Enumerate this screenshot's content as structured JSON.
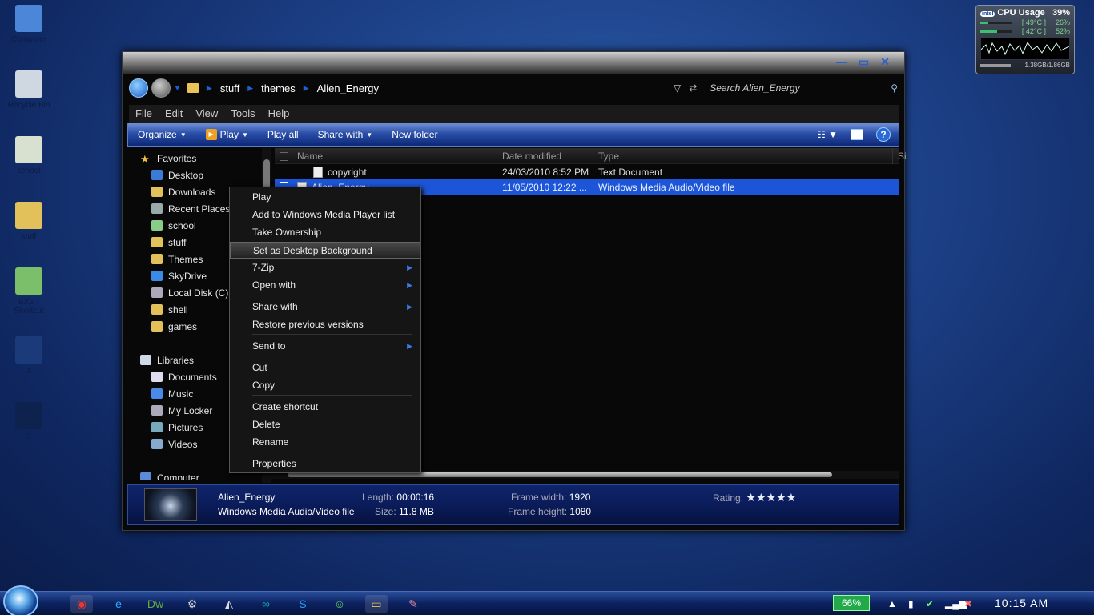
{
  "desktop": {
    "icons": [
      {
        "label": "Computer",
        "icon": "computer-icon",
        "color": "#4b86d8"
      },
      {
        "label": "Recycle Bin",
        "icon": "recycle-bin-icon",
        "color": "#cfd8e0"
      },
      {
        "label": "school",
        "icon": "recycle-folder-icon",
        "color": "#d8e0d0"
      },
      {
        "label": "stuff",
        "icon": "folder-icon",
        "color": "#e3c15a"
      },
      {
        "label": "EXE - Shortcut",
        "icon": "app-icon",
        "color": "#7bbf6a"
      },
      {
        "label": "1",
        "icon": "image-icon",
        "color": "#1b3a7a"
      },
      {
        "label": "2",
        "icon": "image-icon",
        "color": "#0d234d"
      }
    ]
  },
  "gadget": {
    "title": "CPU Usage",
    "total": "39%",
    "core1_temp": "[ 49°C ]",
    "core1_load": "26%",
    "core2_temp": "[ 42°C ]",
    "core2_load": "52%",
    "core1_fill": 0.26,
    "core2_fill": 0.52,
    "memory": "1.38GB/1.86GB",
    "brand": "intel"
  },
  "window": {
    "title_buttons": {
      "minimize": "—",
      "maximize": "▭",
      "close": "✕"
    },
    "breadcrumb": [
      "stuff",
      "themes",
      "Alien_Energy"
    ],
    "search_placeholder": "Search Alien_Energy",
    "menu": [
      "File",
      "Edit",
      "View",
      "Tools",
      "Help"
    ],
    "toolbar": {
      "organize": "Organize",
      "play": "Play",
      "play_all": "Play all",
      "share_with": "Share with",
      "new_folder": "New folder",
      "help": "?"
    },
    "nav": {
      "favorites_header": "Favorites",
      "favorites": [
        {
          "label": "Desktop",
          "color": "#3a7ad8"
        },
        {
          "label": "Downloads",
          "color": "#e3c15a"
        },
        {
          "label": "Recent Places",
          "color": "#9aa"
        },
        {
          "label": "school",
          "color": "#8c8"
        },
        {
          "label": "stuff",
          "color": "#e3c15a"
        },
        {
          "label": "Themes",
          "color": "#e3c15a"
        },
        {
          "label": "SkyDrive",
          "color": "#3a8ae8"
        },
        {
          "label": "Local Disk (C)",
          "color": "#aab"
        },
        {
          "label": "shell",
          "color": "#e3c15a"
        },
        {
          "label": "games",
          "color": "#e3c15a"
        }
      ],
      "libraries_header": "Libraries",
      "libraries": [
        {
          "label": "Documents",
          "color": "#dde"
        },
        {
          "label": "Music",
          "color": "#4a8ae8"
        },
        {
          "label": "My Locker",
          "color": "#aab"
        },
        {
          "label": "Pictures",
          "color": "#7ab"
        },
        {
          "label": "Videos",
          "color": "#8ac"
        }
      ],
      "computer_header": "Computer"
    },
    "columns": [
      "Name",
      "Date modified",
      "Type",
      "Si"
    ],
    "files": [
      {
        "name": "copyright",
        "date": "24/03/2010 8:52 PM",
        "type": "Text Document"
      },
      {
        "name": "Alien_Energy",
        "date": "11/05/2010 12:22 ...",
        "type": "Windows Media Audio/Video file"
      }
    ],
    "details": {
      "name": "Alien_Energy",
      "type": "Windows Media Audio/Video file",
      "length_label": "Length:",
      "length": "00:00:16",
      "size_label": "Size:",
      "size": "11.8 MB",
      "fw_label": "Frame width:",
      "fw": "1920",
      "fh_label": "Frame height:",
      "fh": "1080",
      "rating_label": "Rating:",
      "rating": 5
    }
  },
  "context_menu": [
    {
      "label": "Play"
    },
    {
      "label": "Add to Windows Media Player list"
    },
    {
      "label": "Take Ownership"
    },
    {
      "label": "Set as Desktop Background",
      "highlight": true
    },
    {
      "label": "7-Zip",
      "submenu": true
    },
    {
      "label": "Open with",
      "submenu": true
    },
    {
      "label": "Share with",
      "submenu": true
    },
    {
      "label": "Restore previous versions"
    },
    {
      "label": "Send to",
      "submenu": true
    },
    {
      "label": "Cut"
    },
    {
      "label": "Copy"
    },
    {
      "label": "Create shortcut"
    },
    {
      "label": "Delete"
    },
    {
      "label": "Rename"
    },
    {
      "label": "Properties"
    }
  ],
  "taskbar": {
    "battery": "66%",
    "clock": "10:15 AM",
    "apps": [
      "chrome-icon",
      "ie-icon",
      "dreamweaver-icon",
      "app-icon",
      "unity-icon",
      "arduino-icon",
      "skype-icon",
      "messenger-icon",
      "explorer-icon",
      "paint-icon"
    ]
  }
}
